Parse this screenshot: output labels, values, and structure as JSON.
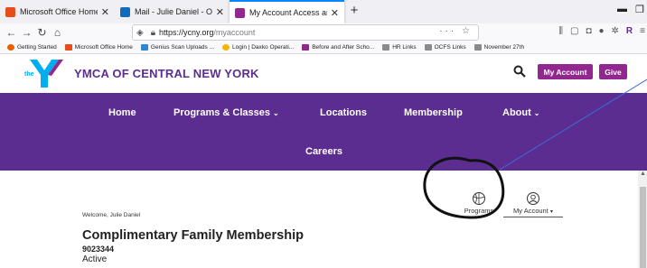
{
  "browser": {
    "tabs": [
      {
        "title": "Microsoft Office Home",
        "favicon_color": "#e74c1c"
      },
      {
        "title": "Mail - Julie Daniel - Outlook",
        "favicon_color": "#0f6cbd"
      },
      {
        "title": "My Account Access and Online",
        "favicon_color": "#92278f"
      }
    ],
    "url": {
      "host": "https://ycny.org",
      "path": "/myaccount"
    },
    "bookmarks": [
      {
        "label": "Getting Started",
        "color": "#e66000"
      },
      {
        "label": "Microsoft Office Home",
        "color": "#e74c1c"
      },
      {
        "label": "Genius Scan Uploads ...",
        "color": "#2b88d8"
      },
      {
        "label": "Login | Daxko Operati...",
        "color": "#f4b400"
      },
      {
        "label": "Before and After Scho...",
        "color": "#92278f"
      },
      {
        "label": "HR Links",
        "color": "#8a8a8a"
      },
      {
        "label": "OCFS Links",
        "color": "#8a8a8a"
      },
      {
        "label": "November 27th",
        "color": "#8a8a8a"
      }
    ]
  },
  "site": {
    "logo_text": "the",
    "org_name": "YMCA OF CENTRAL NEW YORK",
    "my_account_button": "My Account",
    "give_button": "Give",
    "brand_purple": "#5c2d91",
    "button_color": "#92278f",
    "nav": {
      "home": "Home",
      "programs": "Programs & Classes",
      "locations": "Locations",
      "membership": "Membership",
      "about": "About",
      "careers": "Careers"
    }
  },
  "account": {
    "welcome": "Welcome, Julie Daniel",
    "programs_label": "Programs",
    "my_account_label": "My Account",
    "membership_title": "Complimentary Family Membership",
    "membership_id": "9023344",
    "status": "Active"
  }
}
